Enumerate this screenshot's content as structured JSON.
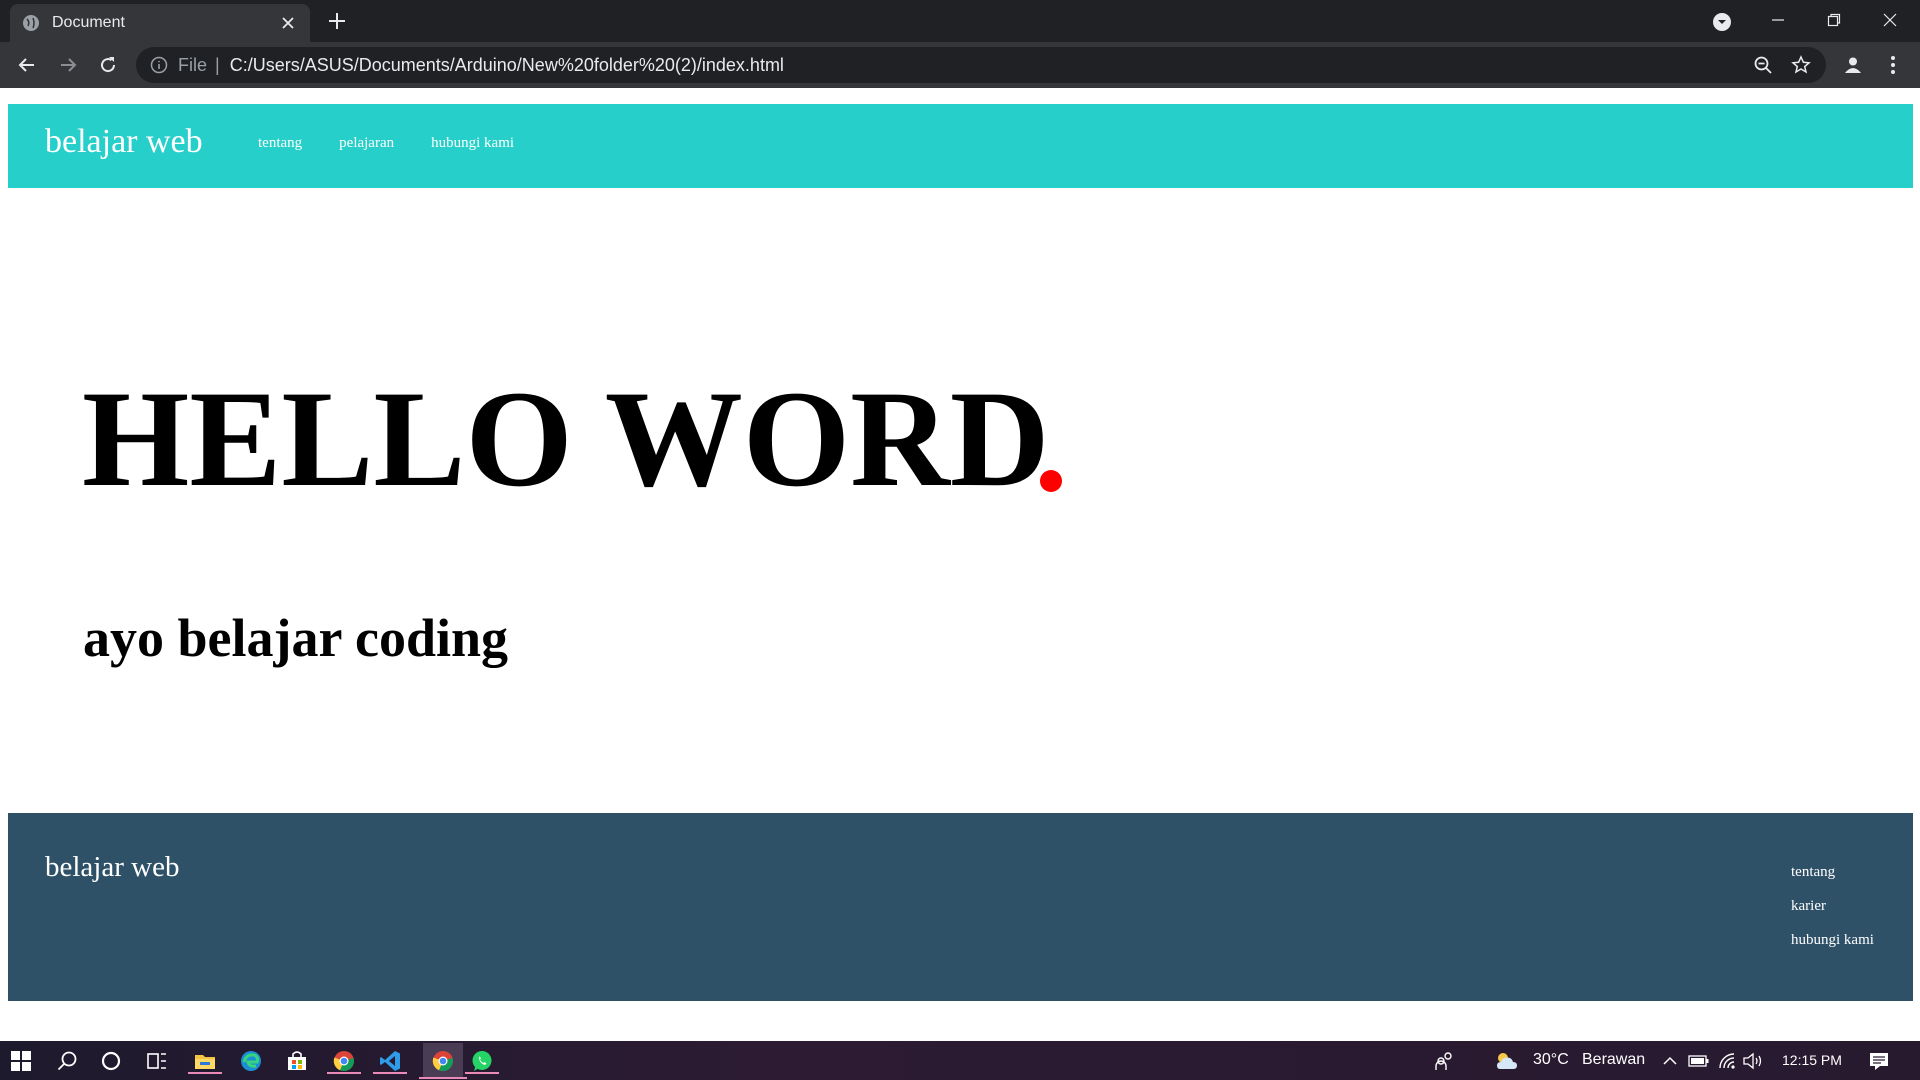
{
  "browser": {
    "tab_title": "Document",
    "omnibox_scheme": "File",
    "omnibox_url": "C:/Users/ASUS/Documents/Arduino/New%20folder%20(2)/index.html"
  },
  "page": {
    "header": {
      "brand": "belajar web",
      "nav": [
        "tentang",
        "pelajaran",
        "hubungi kami"
      ]
    },
    "hero": {
      "title": "HELLO WORD",
      "subtitle": "ayo belajar coding"
    },
    "footer": {
      "brand": "belajar web",
      "links": [
        "tentang",
        "karier",
        "hubungi kami"
      ]
    }
  },
  "taskbar": {
    "weather_temp": "30°C",
    "weather_text": "Berawan",
    "clock": "12:15 PM",
    "pinned": [
      "windows-start-icon",
      "search-icon",
      "cortana-icon",
      "task-view-icon",
      "file-explorer-icon",
      "edge-icon",
      "store-icon",
      "chrome-icon",
      "vscode-icon",
      "chrome-active-icon",
      "whatsapp-icon"
    ]
  },
  "colors": {
    "header_bg": "#26cfc9",
    "footer_bg": "#2e5168",
    "accent_dot": "#ff0000"
  }
}
